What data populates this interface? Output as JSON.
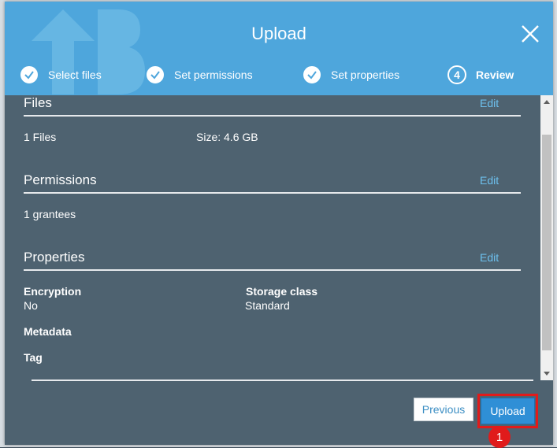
{
  "header": {
    "title": "Upload",
    "steps": [
      {
        "label": "Select files",
        "state": "done"
      },
      {
        "label": "Set permissions",
        "state": "done"
      },
      {
        "label": "Set properties",
        "state": "done"
      },
      {
        "label": "Review",
        "state": "active",
        "number": "4"
      }
    ]
  },
  "files": {
    "title": "Files",
    "edit": "Edit",
    "count": "1 Files",
    "size": "Size: 4.6 GB"
  },
  "permissions": {
    "title": "Permissions",
    "edit": "Edit",
    "grantees": "1 grantees"
  },
  "properties": {
    "title": "Properties",
    "edit": "Edit",
    "encryption_label": "Encryption",
    "encryption_value": "No",
    "storage_label": "Storage class",
    "storage_value": "Standard",
    "metadata_label": "Metadata",
    "tag_label": "Tag"
  },
  "footer": {
    "previous": "Previous",
    "upload": "Upload"
  },
  "annotation": {
    "marker": "1"
  },
  "colors": {
    "header": "#4ea6dc",
    "panel": "#4e6270",
    "link": "#6dc0ee",
    "primary_button": "#2f8fd6",
    "highlight": "#e01b1b"
  }
}
